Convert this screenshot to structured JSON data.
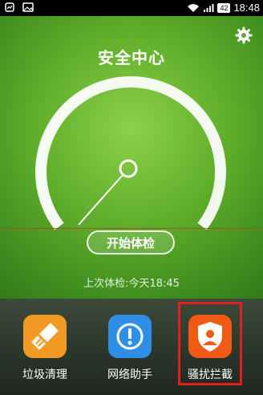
{
  "status_bar": {
    "time": "18:48",
    "battery": "42"
  },
  "header": {
    "title": "安全中心",
    "settings_icon": "gear-icon"
  },
  "scan": {
    "button_label": "开始体检",
    "last_check": "上次体检:今天18:45"
  },
  "tools": [
    {
      "label": "垃圾清理",
      "icon": "broom-icon",
      "color": "#f39a24"
    },
    {
      "label": "网络助手",
      "icon": "exclamation-icon",
      "color": "#2f8ee6"
    },
    {
      "label": "骚扰拦截",
      "icon": "shield-user-icon",
      "color": "#f05a14"
    }
  ],
  "colors": {
    "background_green": "#5fae2a",
    "highlight": "#e02020"
  }
}
